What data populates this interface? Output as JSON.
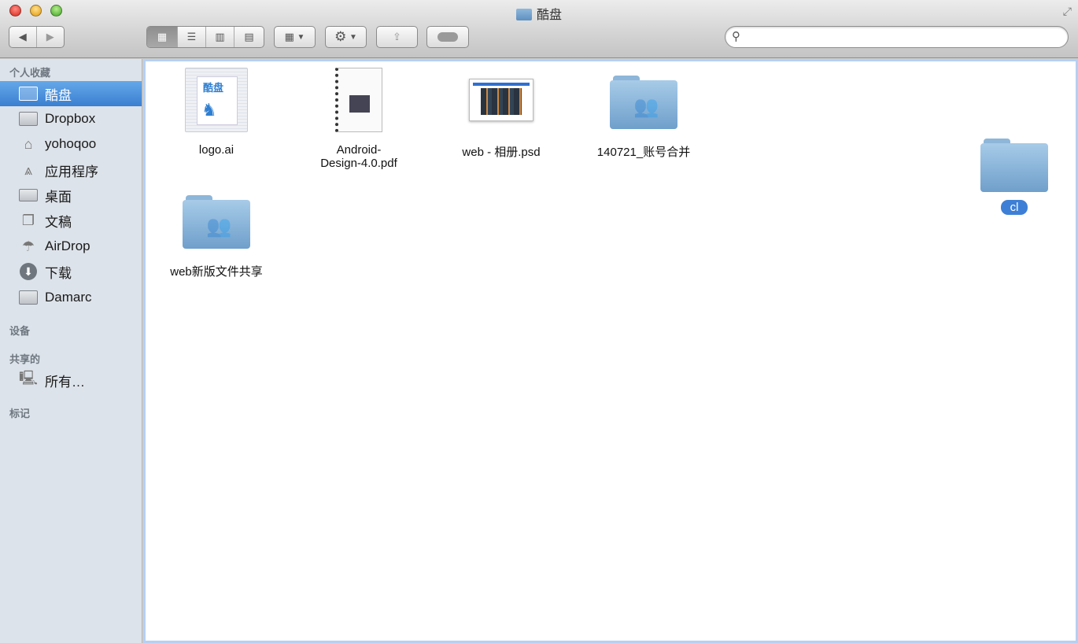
{
  "window": {
    "title": "酷盘"
  },
  "toolbar": {
    "search_placeholder": "",
    "view_modes": [
      "icon",
      "list",
      "column",
      "cover-flow"
    ],
    "active_view": "icon"
  },
  "sidebar": {
    "sections": {
      "favorites": "个人收藏",
      "devices": "设备",
      "shared": "共享的",
      "tags": "标记"
    },
    "items": [
      {
        "label": "酷盘",
        "icon": "folder-icon",
        "selected": true
      },
      {
        "label": "Dropbox",
        "icon": "folder-icon"
      },
      {
        "label": "yohoqoo",
        "icon": "home-icon"
      },
      {
        "label": "应用程序",
        "icon": "applications-icon"
      },
      {
        "label": "桌面",
        "icon": "desktop-icon"
      },
      {
        "label": "文稿",
        "icon": "documents-icon"
      },
      {
        "label": "AirDrop",
        "icon": "airdrop-icon"
      },
      {
        "label": "下载",
        "icon": "download-icon"
      },
      {
        "label": "Damarc",
        "icon": "folder-icon"
      }
    ],
    "shared_items": [
      {
        "label": "所有…",
        "icon": "network-icon"
      }
    ]
  },
  "files": [
    {
      "name": "logo.ai",
      "type": "ai"
    },
    {
      "name_line1": "Android-",
      "name_line2": "Design-4.0.pdf",
      "type": "pdf"
    },
    {
      "name": "web - 相册.psd",
      "type": "psd"
    },
    {
      "name": "140721_账号合并",
      "type": "shared-folder"
    },
    {
      "name": "web新版文件共享",
      "type": "shared-folder"
    },
    {
      "name": "cl",
      "type": "folder",
      "renaming": true
    }
  ]
}
